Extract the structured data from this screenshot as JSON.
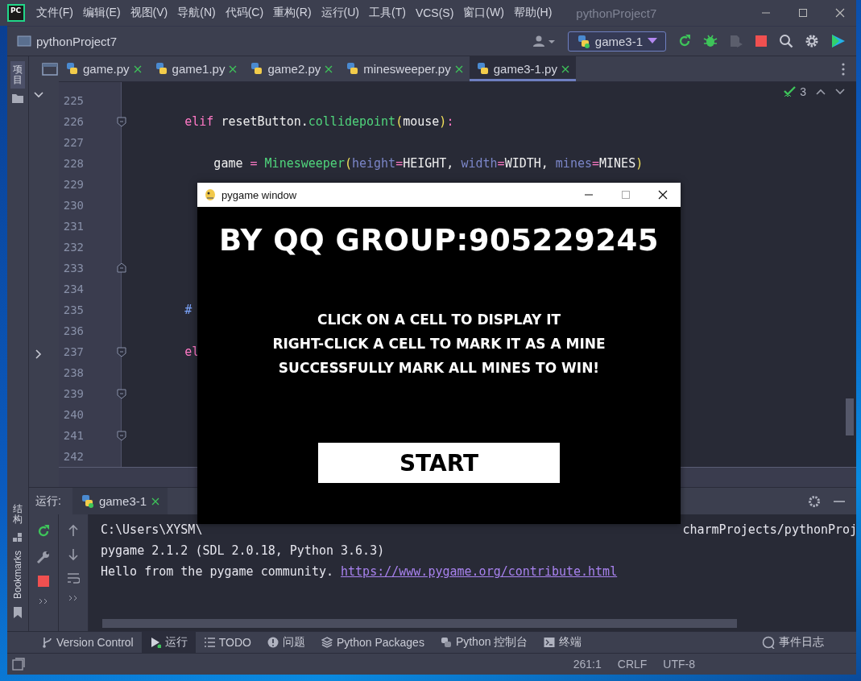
{
  "ide_window": {
    "logo": "PC",
    "menu": [
      "文件(F)",
      "编辑(E)",
      "视图(V)",
      "导航(N)",
      "代码(C)",
      "重构(R)",
      "运行(U)",
      "工具(T)",
      "VCS(S)",
      "窗口(W)",
      "帮助(H)"
    ],
    "title": "pythonProject7"
  },
  "navigation_bar": {
    "project": "pythonProject7",
    "run_configuration": "game3-1"
  },
  "tool_strip": {
    "top": [
      {
        "label": "项目",
        "selected": true
      }
    ],
    "bottom": [
      {
        "kind": "cjk",
        "label": "结构",
        "selected": false
      },
      {
        "kind": "latin",
        "label": "Bookmarks",
        "selected": false
      }
    ]
  },
  "editor_tabs": [
    {
      "label": "game.py",
      "selected": false
    },
    {
      "label": "game1.py",
      "selected": false
    },
    {
      "label": "game2.py",
      "selected": false
    },
    {
      "label": "minesweeper.py",
      "selected": false
    },
    {
      "label": "game3-1.py",
      "selected": true
    }
  ],
  "inspection": {
    "count": "3"
  },
  "code_lines": [
    {
      "number": "225",
      "kind": "plain"
    },
    {
      "number": "226",
      "kind": "fold_start",
      "tokens": [
        {
          "kind": "keyword",
          "text": "        elif"
        },
        {
          "kind": "plain",
          "text": " resetButton."
        },
        {
          "kind": "function",
          "text": "collidepoint"
        },
        {
          "kind": "paren",
          "text": "("
        },
        {
          "kind": "plain",
          "text": "mouse"
        },
        {
          "kind": "paren",
          "text": ")"
        },
        {
          "kind": "operator",
          "text": ":"
        }
      ]
    },
    {
      "number": "227",
      "kind": "plain"
    },
    {
      "number": "228",
      "kind": "plain",
      "tokens": [
        {
          "kind": "plain",
          "text": "            game "
        },
        {
          "kind": "operator",
          "text": "="
        },
        {
          "kind": "function",
          "text": " Minesweeper"
        },
        {
          "kind": "paren",
          "text": "("
        },
        {
          "kind": "param",
          "text": "height"
        },
        {
          "kind": "operator",
          "text": "="
        },
        {
          "kind": "plain",
          "text": "HEIGHT, "
        },
        {
          "kind": "param",
          "text": "width"
        },
        {
          "kind": "operator",
          "text": "="
        },
        {
          "kind": "plain",
          "text": "WIDTH, "
        },
        {
          "kind": "param",
          "text": "mines"
        },
        {
          "kind": "operator",
          "text": "="
        },
        {
          "kind": "plain",
          "text": "MINES"
        },
        {
          "kind": "paren",
          "text": ")"
        }
      ]
    },
    {
      "number": "229",
      "kind": "plain"
    },
    {
      "number": "230",
      "kind": "plain"
    },
    {
      "number": "231",
      "kind": "plain"
    },
    {
      "number": "232",
      "kind": "plain"
    },
    {
      "number": "233",
      "kind": "fold_end"
    },
    {
      "number": "234",
      "kind": "plain"
    },
    {
      "number": "235",
      "kind": "plain",
      "tokens": [
        {
          "kind": "comment",
          "text": "        #"
        }
      ]
    },
    {
      "number": "236",
      "kind": "plain"
    },
    {
      "number": "237",
      "kind": "fold_start",
      "tokens": [
        {
          "kind": "keyword",
          "text": "        el"
        }
      ]
    },
    {
      "number": "238",
      "kind": "plain"
    },
    {
      "number": "239",
      "kind": "fold_start"
    },
    {
      "number": "240",
      "kind": "plain"
    },
    {
      "number": "241",
      "kind": "fold_start"
    },
    {
      "number": "242",
      "kind": "plain"
    }
  ],
  "pygame_window": {
    "title": "pygame window",
    "heading": "BY QQ GROUP:905229245",
    "instructions": [
      "CLICK ON A CELL TO DISPLAY IT",
      "RIGHT-CLICK A CELL TO MARK IT AS A MINE",
      "SUCCESSFULLY MARK ALL MINES TO WIN!"
    ],
    "button": "START"
  },
  "run_panel": {
    "label": "运行:",
    "tab": "game3-1",
    "console_lines": [
      {
        "kind": "split",
        "left": "C:\\Users\\XYSM\\",
        "right": "charmProjects/pythonProj"
      },
      {
        "kind": "text",
        "text": "pygame 2.1.2 (SDL 2.0.18, Python 3.6.3)"
      },
      {
        "kind": "link",
        "text": "Hello from the pygame community. ",
        "link": "https://www.pygame.org/contribute.html"
      }
    ]
  },
  "tool_tabs": [
    {
      "kind": "vcs",
      "label": "Version Control",
      "selected": false
    },
    {
      "kind": "run",
      "label": "运行",
      "selected": true
    },
    {
      "kind": "todo",
      "label": "TODO",
      "selected": false
    },
    {
      "kind": "problems",
      "label": "问题",
      "selected": false
    },
    {
      "kind": "packages",
      "label": "Python Packages",
      "selected": false
    },
    {
      "kind": "console",
      "label": "Python 控制台",
      "selected": false
    },
    {
      "kind": "terminal",
      "label": "终端",
      "selected": false
    }
  ],
  "event_log": "事件日志",
  "status_bar": [
    "261:1",
    "CRLF",
    "UTF-8"
  ]
}
